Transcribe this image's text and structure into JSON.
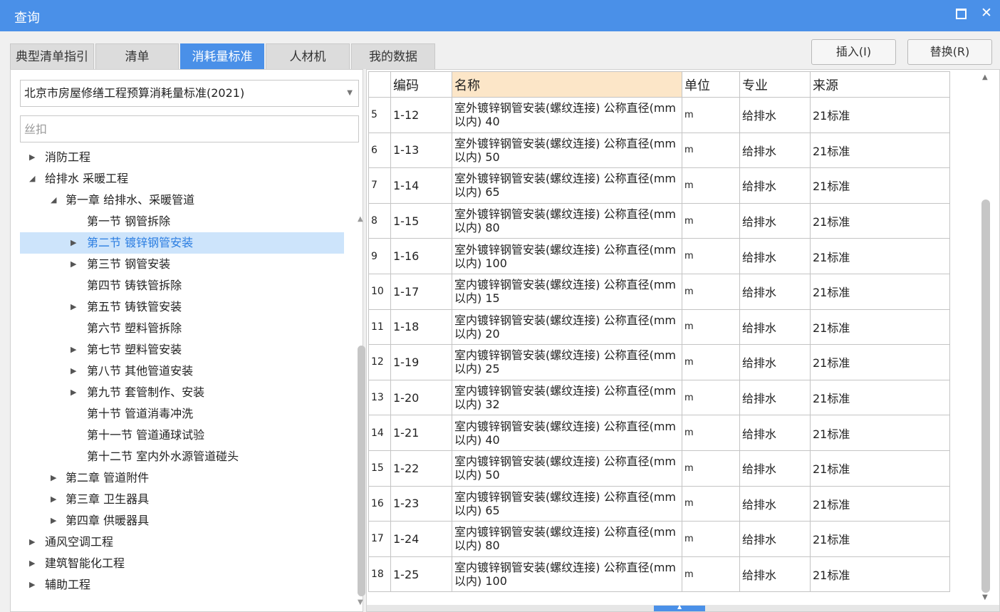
{
  "window": {
    "title": "查询"
  },
  "tabs": [
    {
      "label": "典型清单指引"
    },
    {
      "label": "清单"
    },
    {
      "label": "消耗量标准"
    },
    {
      "label": "人材机"
    },
    {
      "label": "我的数据"
    }
  ],
  "active_tab": 2,
  "buttons": {
    "insert": "插入(I)",
    "replace": "替换(R)"
  },
  "left": {
    "standard": "北京市房屋修缮工程预算消耗量标准(2021)",
    "filter_value": "",
    "filter_placeholder": "丝扣",
    "tree": [
      {
        "label": "消防工程",
        "level": 0,
        "arrow": "collapsed"
      },
      {
        "label": "给排水 采暖工程",
        "level": 0,
        "arrow": "expanded"
      },
      {
        "label": "第一章 给排水、采暖管道",
        "level": 1,
        "arrow": "expanded"
      },
      {
        "label": "第一节 钢管拆除",
        "level": 2,
        "arrow": "none"
      },
      {
        "label": "第二节 镀锌钢管安装",
        "level": 2,
        "arrow": "collapsed",
        "selected": true
      },
      {
        "label": "第三节 钢管安装",
        "level": 2,
        "arrow": "collapsed"
      },
      {
        "label": "第四节 铸铁管拆除",
        "level": 2,
        "arrow": "none"
      },
      {
        "label": "第五节 铸铁管安装",
        "level": 2,
        "arrow": "collapsed"
      },
      {
        "label": "第六节 塑料管拆除",
        "level": 2,
        "arrow": "none"
      },
      {
        "label": "第七节 塑料管安装",
        "level": 2,
        "arrow": "collapsed"
      },
      {
        "label": "第八节 其他管道安装",
        "level": 2,
        "arrow": "collapsed"
      },
      {
        "label": "第九节 套管制作、安装",
        "level": 2,
        "arrow": "collapsed"
      },
      {
        "label": "第十节 管道消毒冲洗",
        "level": 2,
        "arrow": "none"
      },
      {
        "label": "第十一节 管道通球试验",
        "level": 2,
        "arrow": "none"
      },
      {
        "label": "第十二节 室内外水源管道碰头",
        "level": 2,
        "arrow": "none"
      },
      {
        "label": "第二章 管道附件",
        "level": 1,
        "arrow": "collapsed"
      },
      {
        "label": "第三章 卫生器具",
        "level": 1,
        "arrow": "collapsed"
      },
      {
        "label": "第四章 供暖器具",
        "level": 1,
        "arrow": "collapsed"
      },
      {
        "label": "通风空调工程",
        "level": 0,
        "arrow": "collapsed"
      },
      {
        "label": "建筑智能化工程",
        "level": 0,
        "arrow": "collapsed"
      },
      {
        "label": "辅助工程",
        "level": 0,
        "arrow": "collapsed"
      }
    ]
  },
  "grid": {
    "headers": {
      "code": "编码",
      "name": "名称",
      "unit": "单位",
      "major": "专业",
      "source": "来源"
    },
    "rows": [
      {
        "idx": "5",
        "code": "1-12",
        "name": "室外镀锌钢管安装(螺纹连接) 公称直径(mm以内) 40",
        "unit": "m",
        "major": "给排水",
        "source": "21标准"
      },
      {
        "idx": "6",
        "code": "1-13",
        "name": "室外镀锌钢管安装(螺纹连接) 公称直径(mm以内) 50",
        "unit": "m",
        "major": "给排水",
        "source": "21标准"
      },
      {
        "idx": "7",
        "code": "1-14",
        "name": "室外镀锌钢管安装(螺纹连接) 公称直径(mm以内) 65",
        "unit": "m",
        "major": "给排水",
        "source": "21标准"
      },
      {
        "idx": "8",
        "code": "1-15",
        "name": "室外镀锌钢管安装(螺纹连接) 公称直径(mm以内) 80",
        "unit": "m",
        "major": "给排水",
        "source": "21标准"
      },
      {
        "idx": "9",
        "code": "1-16",
        "name": "室外镀锌钢管安装(螺纹连接) 公称直径(mm以内) 100",
        "unit": "m",
        "major": "给排水",
        "source": "21标准"
      },
      {
        "idx": "10",
        "code": "1-17",
        "name": "室内镀锌钢管安装(螺纹连接) 公称直径(mm以内) 15",
        "unit": "m",
        "major": "给排水",
        "source": "21标准"
      },
      {
        "idx": "11",
        "code": "1-18",
        "name": "室内镀锌钢管安装(螺纹连接) 公称直径(mm以内) 20",
        "unit": "m",
        "major": "给排水",
        "source": "21标准"
      },
      {
        "idx": "12",
        "code": "1-19",
        "name": "室内镀锌钢管安装(螺纹连接) 公称直径(mm以内) 25",
        "unit": "m",
        "major": "给排水",
        "source": "21标准"
      },
      {
        "idx": "13",
        "code": "1-20",
        "name": "室内镀锌钢管安装(螺纹连接) 公称直径(mm以内) 32",
        "unit": "m",
        "major": "给排水",
        "source": "21标准"
      },
      {
        "idx": "14",
        "code": "1-21",
        "name": "室内镀锌钢管安装(螺纹连接) 公称直径(mm以内) 40",
        "unit": "m",
        "major": "给排水",
        "source": "21标准"
      },
      {
        "idx": "15",
        "code": "1-22",
        "name": "室内镀锌钢管安装(螺纹连接) 公称直径(mm以内) 50",
        "unit": "m",
        "major": "给排水",
        "source": "21标准"
      },
      {
        "idx": "16",
        "code": "1-23",
        "name": "室内镀锌钢管安装(螺纹连接) 公称直径(mm以内) 65",
        "unit": "m",
        "major": "给排水",
        "source": "21标准"
      },
      {
        "idx": "17",
        "code": "1-24",
        "name": "室内镀锌钢管安装(螺纹连接) 公称直径(mm以内) 80",
        "unit": "m",
        "major": "给排水",
        "source": "21标准"
      },
      {
        "idx": "18",
        "code": "1-25",
        "name": "室内镀锌钢管安装(螺纹连接) 公称直径(mm以内) 100",
        "unit": "m",
        "major": "给排水",
        "source": "21标准"
      }
    ]
  },
  "colors": {
    "accent": "#4a90e8",
    "selected_row": "#cde4fb",
    "sorted_header": "#fce6c8"
  }
}
